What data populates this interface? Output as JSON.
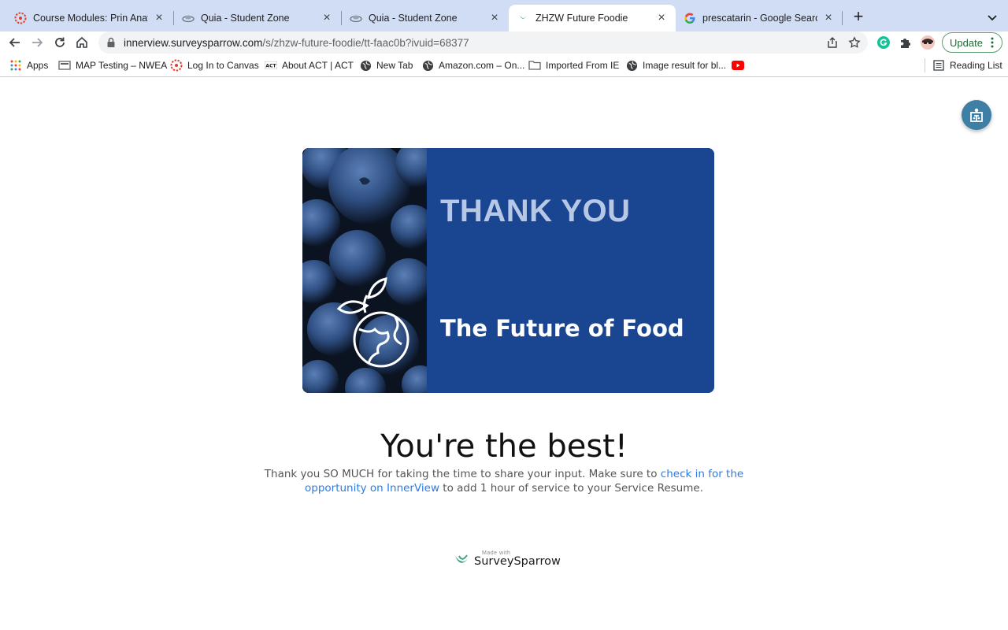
{
  "tabs": [
    {
      "title": "Course Modules: Prin Anat/Phy",
      "favicon": "canvas-icon",
      "active": false
    },
    {
      "title": "Quia - Student Zone",
      "favicon": "quia-icon",
      "active": false
    },
    {
      "title": "Quia - Student Zone",
      "favicon": "quia-icon",
      "active": false
    },
    {
      "title": "ZHZW Future Foodie",
      "favicon": "surveysparrow-icon",
      "active": true
    },
    {
      "title": "prescatarin - Google Search",
      "favicon": "google-icon",
      "active": false
    }
  ],
  "toolbar": {
    "url_host": "innerview.surveysparrow.com",
    "url_path": "/s/zhzw-future-foodie/tt-faac0b?ivuid=68377",
    "update_label": "Update"
  },
  "bookmarks": [
    {
      "label": "Apps",
      "icon": "apps-grid-icon"
    },
    {
      "label": "MAP Testing – NWEA",
      "icon": "bookmark-page-icon"
    },
    {
      "label": "Log In to Canvas",
      "icon": "canvas-icon"
    },
    {
      "label": "About ACT | ACT",
      "icon": "act-icon"
    },
    {
      "label": "New Tab",
      "icon": "globe-icon"
    },
    {
      "label": "Amazon.com – On...",
      "icon": "globe-icon"
    },
    {
      "label": "Imported From IE",
      "icon": "folder-icon"
    },
    {
      "label": "Image result for bl...",
      "icon": "globe-icon"
    },
    {
      "label": "",
      "icon": "youtube-icon"
    }
  ],
  "reading_list": "Reading List",
  "page": {
    "hero_thanks": "THANK YOU",
    "hero_subtitle": "The Future of Food",
    "headline": "You're the best!",
    "message_part1": "Thank you SO MUCH for taking the time to share your input. Make sure to ",
    "message_link": "check in for the opportunity on InnerView",
    "message_part2": " to add 1 hour of service to your Service Resume.",
    "made_with": "Made with",
    "brand": "SurveySparrow"
  },
  "colors": {
    "tabstrip": "#d1ddf4",
    "hero_blue": "#1a4590",
    "link": "#2c7be5",
    "brand_green": "#3aa57a",
    "a11y_button": "#3d7fa5"
  }
}
